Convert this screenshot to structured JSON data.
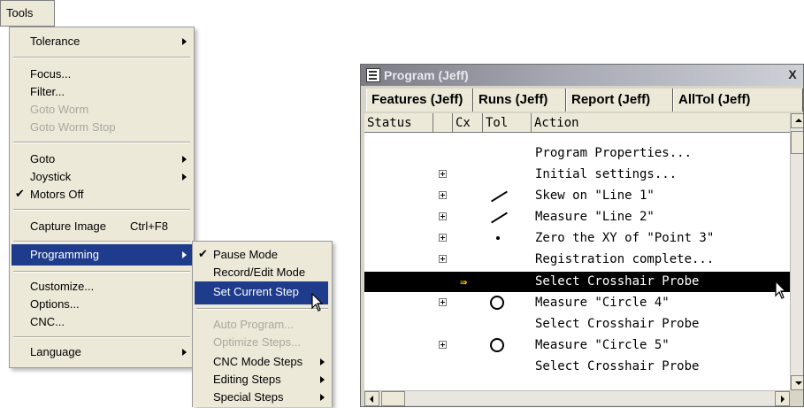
{
  "tools_menu": {
    "title": "Tools",
    "items": [
      {
        "label": "Tolerance",
        "submenu": true
      },
      {
        "label": "Focus..."
      },
      {
        "label": "Filter..."
      },
      {
        "label": "Goto Worm",
        "disabled": true
      },
      {
        "label": "Goto Worm Stop",
        "disabled": true
      },
      {
        "label": "Goto",
        "submenu": true
      },
      {
        "label": "Joystick",
        "submenu": true
      },
      {
        "label": "Motors Off",
        "checked": true
      },
      {
        "label": "Capture Image",
        "shortcut": "Ctrl+F8"
      },
      {
        "label": "Programming",
        "submenu": true,
        "selected": true
      },
      {
        "label": "Customize..."
      },
      {
        "label": "Options..."
      },
      {
        "label": "CNC..."
      },
      {
        "label": "Language",
        "submenu": true
      }
    ]
  },
  "programming_submenu": {
    "items": [
      {
        "label": "Pause Mode",
        "checked": true
      },
      {
        "label": "Record/Edit Mode"
      },
      {
        "label": "Set Current Step",
        "selected": true
      },
      {
        "label": "Auto Program...",
        "disabled": true
      },
      {
        "label": "Optimize Steps...",
        "disabled": true
      },
      {
        "label": "CNC Mode Steps",
        "submenu": true
      },
      {
        "label": "Editing Steps",
        "submenu": true
      },
      {
        "label": "Special Steps",
        "submenu": true
      }
    ]
  },
  "program_window": {
    "title": "Program (Jeff)",
    "close_glyph": "X",
    "tabs": [
      "Features (Jeff)",
      "Runs (Jeff)",
      "Report (Jeff)",
      "AllTol (Jeff)"
    ],
    "columns": [
      "Status",
      "",
      "Cx",
      "Tol",
      "Action"
    ],
    "rows": [
      {
        "action": "Program Properties...",
        "expand": false,
        "tol": ""
      },
      {
        "action": "Initial settings...",
        "expand": true,
        "tol": ""
      },
      {
        "action": "Skew on \"Line 1\"",
        "expand": true,
        "tol": "line-icon"
      },
      {
        "action": "Measure \"Line 2\"",
        "expand": true,
        "tol": "line-icon"
      },
      {
        "action": "Zero the XY of \"Point 3\"",
        "expand": true,
        "tol": "point-icon"
      },
      {
        "action": "Registration complete...",
        "expand": true,
        "tol": ""
      },
      {
        "action": "Select Crosshair Probe",
        "expand": false,
        "tol": "",
        "current": true,
        "selected": true
      },
      {
        "action": "Measure \"Circle 4\"",
        "expand": true,
        "tol": "circle-icon"
      },
      {
        "action": "Select Crosshair Probe",
        "expand": false,
        "tol": ""
      },
      {
        "action": "Measure \"Circle 5\"",
        "expand": true,
        "tol": "circle-icon"
      },
      {
        "action": "Select Crosshair Probe",
        "expand": false,
        "tol": ""
      }
    ]
  },
  "colors": {
    "menu_bg": "#ece9d8",
    "menu_highlight": "#1f3c8c",
    "row_selected_bg": "#000000",
    "current_step_arrow": "#f5c000"
  }
}
